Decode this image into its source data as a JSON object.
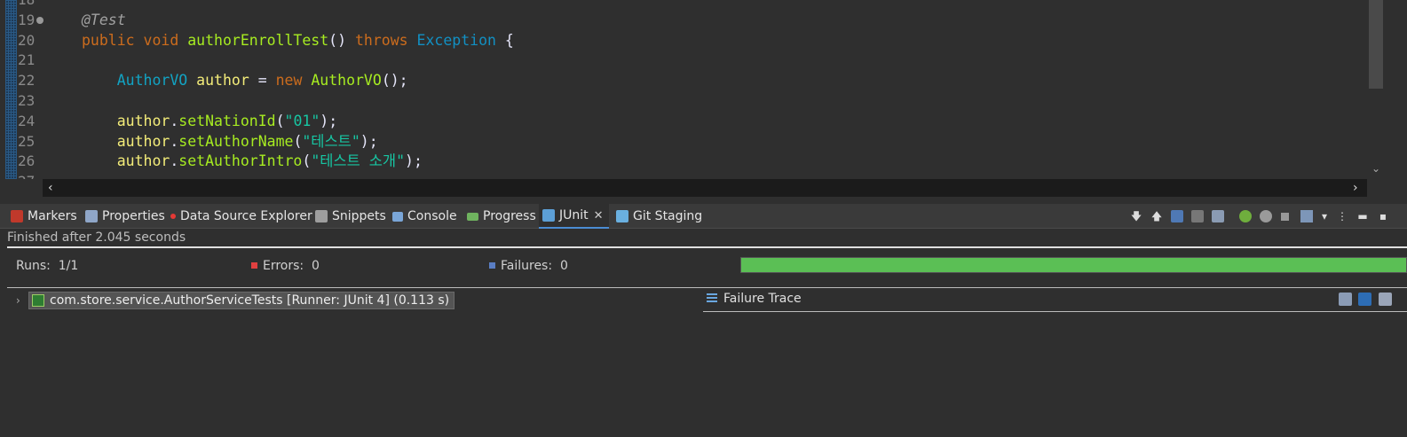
{
  "editor": {
    "lines": [
      {
        "num": "18",
        "tokens": []
      },
      {
        "num": "19",
        "tokens": [
          {
            "c": "annot",
            "t": "@Test"
          }
        ]
      },
      {
        "num": "20",
        "tokens": [
          {
            "c": "kw",
            "t": "public "
          },
          {
            "c": "kw",
            "t": "void "
          },
          {
            "c": "fn",
            "t": "authorEnrollTest"
          },
          {
            "c": "op",
            "t": "() "
          },
          {
            "c": "kw",
            "t": "throws "
          },
          {
            "c": "typ",
            "t": "Exception"
          },
          {
            "c": "op",
            "t": " {"
          }
        ]
      },
      {
        "num": "21",
        "tokens": []
      },
      {
        "num": "22",
        "tokens": [
          {
            "c": "op",
            "t": "    "
          },
          {
            "c": "typ2",
            "t": "AuthorVO "
          },
          {
            "c": "var",
            "t": "author"
          },
          {
            "c": "op",
            "t": " = "
          },
          {
            "c": "kw",
            "t": "new "
          },
          {
            "c": "fn",
            "t": "AuthorVO"
          },
          {
            "c": "op",
            "t": "();"
          }
        ]
      },
      {
        "num": "23",
        "tokens": []
      },
      {
        "num": "24",
        "tokens": [
          {
            "c": "op",
            "t": "    "
          },
          {
            "c": "var",
            "t": "author"
          },
          {
            "c": "op",
            "t": "."
          },
          {
            "c": "fn",
            "t": "setNationId"
          },
          {
            "c": "op",
            "t": "("
          },
          {
            "c": "str",
            "t": "\"01\""
          },
          {
            "c": "op",
            "t": ");"
          }
        ]
      },
      {
        "num": "25",
        "tokens": [
          {
            "c": "op",
            "t": "    "
          },
          {
            "c": "var",
            "t": "author"
          },
          {
            "c": "op",
            "t": "."
          },
          {
            "c": "fn",
            "t": "setAuthorName"
          },
          {
            "c": "op",
            "t": "("
          },
          {
            "c": "str",
            "t": "\"테스트\""
          },
          {
            "c": "op",
            "t": ");"
          }
        ]
      },
      {
        "num": "26",
        "tokens": [
          {
            "c": "op",
            "t": "    "
          },
          {
            "c": "var",
            "t": "author"
          },
          {
            "c": "op",
            "t": "."
          },
          {
            "c": "fn",
            "t": "setAuthorIntro"
          },
          {
            "c": "op",
            "t": "("
          },
          {
            "c": "str",
            "t": "\"테스트 소개\""
          },
          {
            "c": "op",
            "t": ");"
          }
        ]
      },
      {
        "num": "27",
        "tokens": []
      }
    ]
  },
  "tabs": [
    {
      "label": "Markers",
      "icon": "markers-icon",
      "color": "#c0392b"
    },
    {
      "label": "Properties",
      "icon": "properties-icon",
      "color": "#8fa6c8"
    },
    {
      "label": "Data Source Explorer",
      "icon": "data-source-icon",
      "color": "#e53935"
    },
    {
      "label": "Snippets",
      "icon": "snippets-icon",
      "color": "#9e9e9e"
    },
    {
      "label": "Console",
      "icon": "console-icon",
      "color": "#7aa6d8"
    },
    {
      "label": "Progress",
      "icon": "progress-icon",
      "color": "#6fb35f"
    },
    {
      "label": "JUnit",
      "icon": "junit-icon",
      "color": "#5c9fd6"
    },
    {
      "label": "Git Staging",
      "icon": "git-staging-icon",
      "color": "#6ab0e0"
    }
  ],
  "junit": {
    "finished": "Finished after 2.045 seconds",
    "runs_label": "Runs:",
    "runs_value": "1/1",
    "errors_label": "Errors:",
    "errors_value": "0",
    "failures_label": "Failures:",
    "failures_value": "0",
    "progress": 1.0,
    "progress_color": "#5bbf55",
    "test_item": "com.store.service.AuthorServiceTests [Runner: JUnit 4] (0.113 s)",
    "failure_trace": "Failure Trace"
  },
  "colors": {
    "background": "#2f2f2f",
    "keyword": "#cc6c1d",
    "string": "#17c6a3",
    "method": "#a7ec21"
  }
}
